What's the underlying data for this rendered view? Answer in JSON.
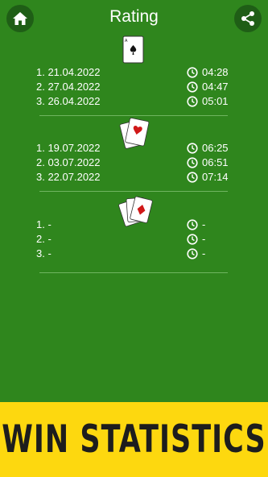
{
  "header": {
    "title": "Rating",
    "home_icon": "home-icon",
    "share_icon": "share-icon"
  },
  "sections": [
    {
      "icon": "one-card-icon",
      "rows": [
        {
          "date": "1. 21.04.2022",
          "time": "04:28"
        },
        {
          "date": "2. 27.04.2022",
          "time": "04:47"
        },
        {
          "date": "3. 26.04.2022",
          "time": "05:01"
        }
      ]
    },
    {
      "icon": "two-cards-icon",
      "rows": [
        {
          "date": "1. 19.07.2022",
          "time": "06:25"
        },
        {
          "date": "2. 03.07.2022",
          "time": "06:51"
        },
        {
          "date": "3. 22.07.2022",
          "time": "07:14"
        }
      ]
    },
    {
      "icon": "three-cards-icon",
      "rows": [
        {
          "date": "1. -",
          "time": "-"
        },
        {
          "date": "2. -",
          "time": "-"
        },
        {
          "date": "3. -",
          "time": "-"
        }
      ]
    }
  ],
  "banner": {
    "text": "WIN STATISTICS"
  },
  "colors": {
    "background": "#2f861d",
    "button": "#1f5e16",
    "banner": "#fdd80f",
    "banner_text": "#1d1d1d"
  }
}
